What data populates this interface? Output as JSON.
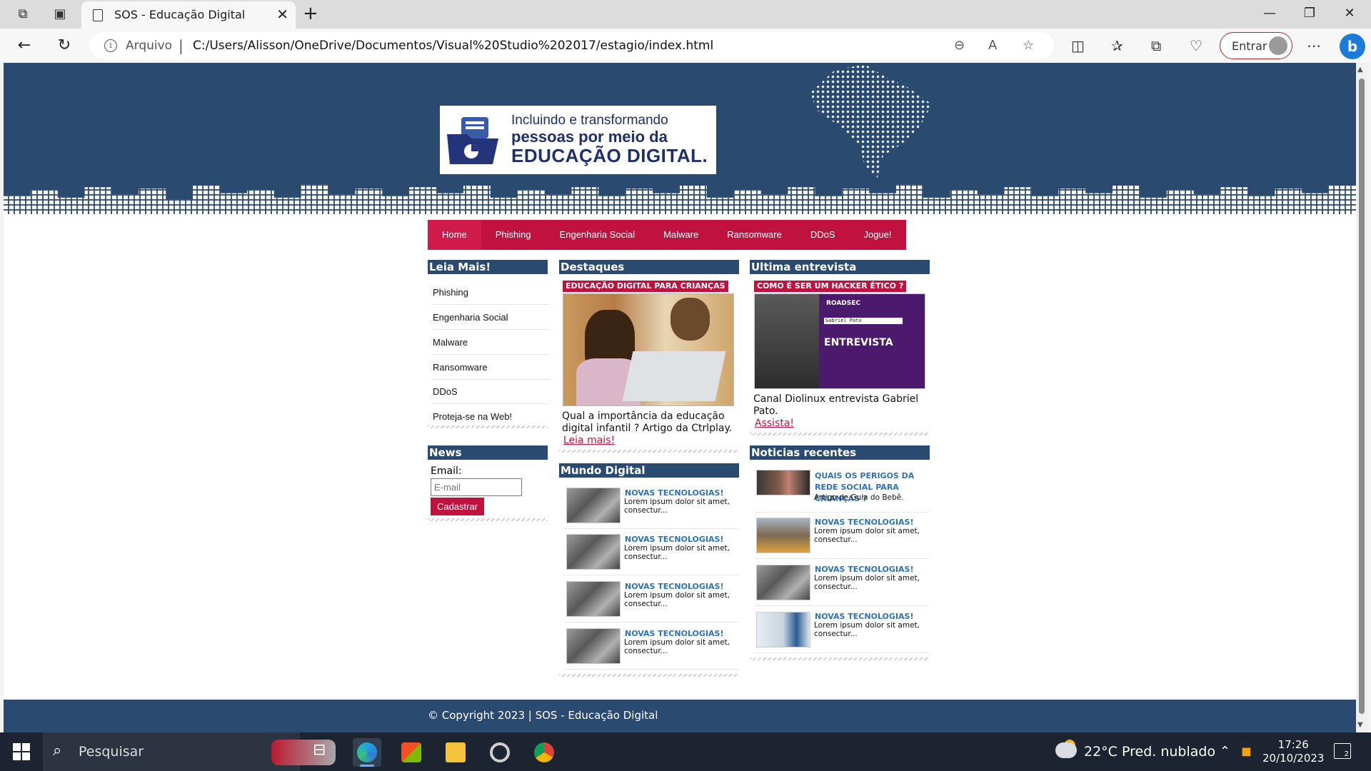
{
  "browser": {
    "tab_title": "SOS - Educação Digital",
    "address_prefix": "Arquivo",
    "url": "C:/Users/Alisson/OneDrive/Documentos/Visual%20Studio%202017/estagio/index.html",
    "profile_button": "Entrar",
    "bing_label": "b"
  },
  "site": {
    "logo": {
      "line1": "Incluindo e transformando",
      "line2": "pessoas por meio da",
      "line3": "EDUCAÇÃO DIGITAL."
    },
    "menu": [
      "Home",
      "Phishing",
      "Engenharia Social",
      "Malware",
      "Ransomware",
      "DDoS",
      "Jogue!"
    ],
    "sidebar": {
      "title": "Leia Mais!",
      "links": [
        "Phishing",
        "Engenharia Social",
        "Malware",
        "Ransomware",
        "DDoS",
        "Proteja-se na Web!"
      ],
      "news_title": "News",
      "email_label": "Email:",
      "email_placeholder": "E-mail",
      "subscribe_button": "Cadastrar"
    },
    "highlights": {
      "title": "Destaques",
      "tag": "EDUCAÇÃO DIGITAL PARA CRIANÇAS",
      "text": "Qual a importância da educação digital infantil ? Artigo da Ctrlplay.",
      "link": "Leia mais!"
    },
    "interview": {
      "title": "Ultima entrevista",
      "tag": "COMO É SER UM HACKER ÉTICO ?",
      "image_brand": "ROADSEC",
      "image_name": "Gabriel Pato",
      "image_title": "ENTREVISTA",
      "text": "Canal Diolinux entrevista Gabriel Pato.",
      "link": "Assista!"
    },
    "digital_world": {
      "title": "Mundo Digital",
      "items": [
        {
          "title": "NOVAS TECNOLOGIAS!",
          "text": "Lorem ipsum dolor sit amet, consectur..."
        },
        {
          "title": "NOVAS TECNOLOGIAS!",
          "text": "Lorem ipsum dolor sit amet, consectur..."
        },
        {
          "title": "NOVAS TECNOLOGIAS!",
          "text": "Lorem ipsum dolor sit amet, consectur..."
        },
        {
          "title": "NOVAS TECNOLOGIAS!",
          "text": "Lorem ipsum dolor sit amet, consectur..."
        }
      ]
    },
    "recent_news": {
      "title": "Noticias recentes",
      "items": [
        {
          "title": "QUAIS OS PERIGOS DA REDE SOCIAL PARA CRIANÇAS ?",
          "text": "Artigo de Guia do Bebê."
        },
        {
          "title": "NOVAS TECNOLOGIAS!",
          "text": "Lorem ipsum dolor sit amet, consectur..."
        },
        {
          "title": "NOVAS TECNOLOGIAS!",
          "text": "Lorem ipsum dolor sit amet, consectur..."
        },
        {
          "title": "NOVAS TECNOLOGIAS!",
          "text": "Lorem ipsum dolor sit amet, consectur..."
        }
      ]
    },
    "footer": "© Copyright 2023 | SOS - Educação Digital"
  },
  "taskbar": {
    "search_label": "Pesquisar",
    "weather": "22°C  Pred. nublado",
    "time": "17:26",
    "date": "20/10/2023",
    "notifications": "2"
  },
  "colors": {
    "header_blue": "#2b4a70",
    "accent_red": "#c1123f",
    "link_blue": "#2e73b8"
  }
}
